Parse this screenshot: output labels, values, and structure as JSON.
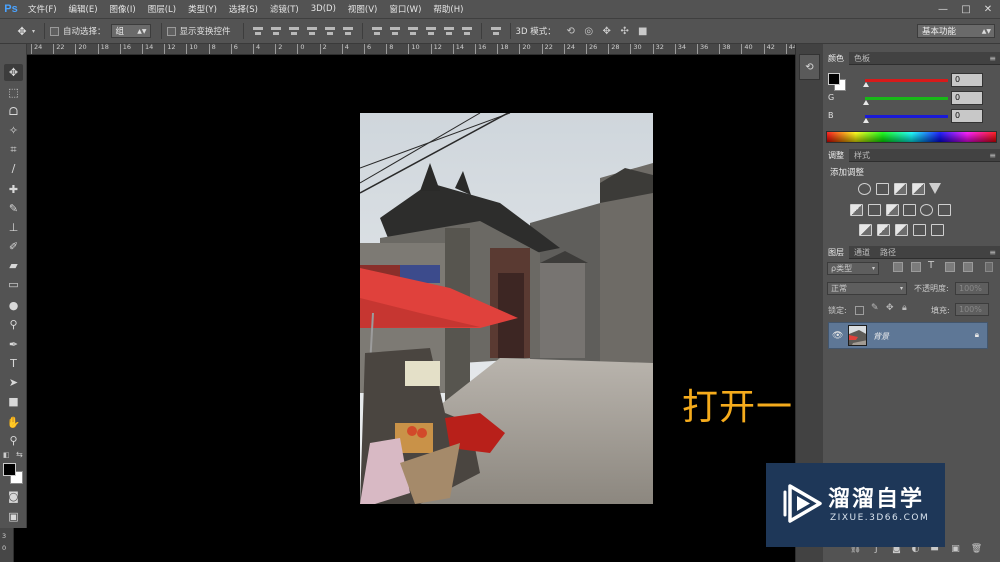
{
  "app": {
    "logo": "Ps"
  },
  "menu": [
    "文件(F)",
    "编辑(E)",
    "图像(I)",
    "图层(L)",
    "类型(Y)",
    "选择(S)",
    "滤镜(T)",
    "3D(D)",
    "视图(V)",
    "窗口(W)",
    "帮助(H)"
  ],
  "window_controls": {
    "minimize": "—",
    "maximize": "□",
    "close": "✕"
  },
  "options_bar": {
    "auto_select_label": "自动选择：",
    "auto_select_value": "组",
    "show_transform_label": "显示变换控件",
    "mode_3d_label": "3D 模式：",
    "workspace": "基本功能"
  },
  "ruler": {
    "top_ticks": [
      "24",
      "22",
      "20",
      "18",
      "16",
      "14",
      "12",
      "10",
      "8",
      "6",
      "4",
      "2",
      "0",
      "2",
      "4",
      "6",
      "8",
      "10",
      "12",
      "14",
      "16",
      "18",
      "20",
      "22",
      "24",
      "26",
      "28",
      "30",
      "32",
      "34",
      "36",
      "38",
      "40",
      "42",
      "44",
      "46"
    ],
    "left_nums": [
      "3",
      "0"
    ]
  },
  "panels": {
    "color": {
      "tabs": [
        "颜色",
        "色板"
      ],
      "channels": [
        {
          "letter": "R",
          "value": "0",
          "color": "#d81a1a"
        },
        {
          "letter": "G",
          "value": "0",
          "color": "#18b818"
        },
        {
          "letter": "B",
          "value": "0",
          "color": "#1a1ad8"
        }
      ]
    },
    "adjustments": {
      "tabs": [
        "调整",
        "样式"
      ],
      "title": "添加调整"
    },
    "layers": {
      "tabs": [
        "图层",
        "通道",
        "路径"
      ],
      "filter_label": "ρ类型",
      "blend_mode": "正常",
      "opacity_label": "不透明度:",
      "opacity_value": "100%",
      "lock_label": "锁定:",
      "fill_label": "填充:",
      "fill_value": "100%",
      "layer_name": "背景"
    }
  },
  "canvas": {
    "caption": "打开一张图"
  },
  "watermark": {
    "title": "溜溜自学",
    "url": "ZIXUE.3D66.COM"
  }
}
